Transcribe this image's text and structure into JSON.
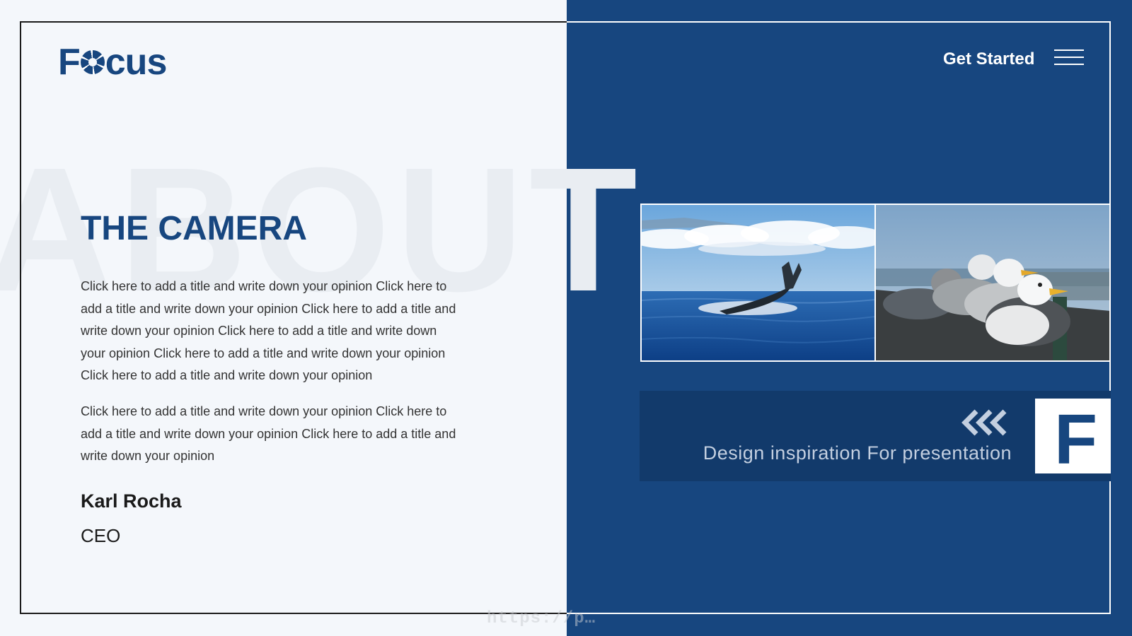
{
  "brand": {
    "logo_prefix": "F",
    "logo_suffix": "cus"
  },
  "header": {
    "cta_label": "Get Started",
    "menu_icon": "hamburger-menu-icon"
  },
  "main": {
    "background_word": "ABOUT",
    "title": "THE CAMERA",
    "paragraph_1": "Click here to add a title  and write down your opinion Click here to add a title and write down your opinion Click here to add a title and write down your opinion Click here to add a title  and write down your opinion Click here to add a title and write down your opinion Click here to add a title and write down your opinion",
    "paragraph_2": "Click here to add a title  and write down your opinion Click here to add a title and write down your opinion Click here to add a title and write down your opinion",
    "person": {
      "name": "Karl Rocha",
      "role": "CEO"
    }
  },
  "gallery": {
    "photos": [
      "whale-tail-ocean",
      "seagulls-on-railing"
    ]
  },
  "banner": {
    "text": "Design inspiration For presentation",
    "letter": "F",
    "arrow_icon": "triple-chevron-left-icon"
  },
  "watermark": "https://p…",
  "colors": {
    "primary": "#17467f",
    "banner": "#123a6b",
    "light_bg": "#f4f7fb",
    "white": "#ffffff"
  }
}
